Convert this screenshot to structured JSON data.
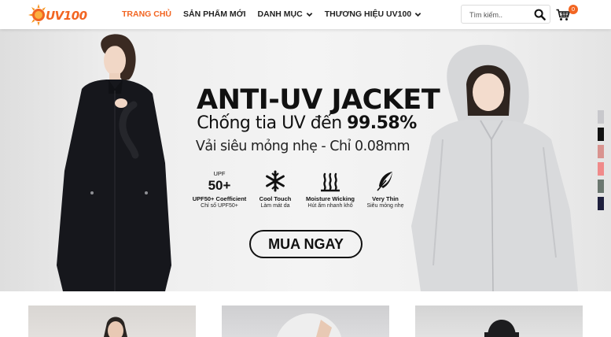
{
  "header": {
    "logo_text": "UV100",
    "nav": [
      {
        "label": "TRANG CHỦ",
        "active": true,
        "has_dropdown": false
      },
      {
        "label": "SẢN PHẨM MỚI",
        "active": false,
        "has_dropdown": false
      },
      {
        "label": "DANH MỤC",
        "active": false,
        "has_dropdown": true
      },
      {
        "label": "THƯƠNG HIỆU UV100",
        "active": false,
        "has_dropdown": true
      }
    ],
    "search_placeholder": "Tìm kiếm..",
    "cart_count": "0"
  },
  "banner": {
    "headline": "ANTI-UV JACKET",
    "subline_prefix": "Chống tia UV đến ",
    "subline_value": "99.58%",
    "thin_line": "Vải siêu mỏng nhẹ - Chỉ 0.08mm",
    "features": [
      {
        "icon": "upf50-icon",
        "badge_top": "UPF",
        "badge_main": "50+",
        "title": "UPF50+ Coefficient",
        "desc": "Chỉ số UPF50+"
      },
      {
        "icon": "snowflake-icon",
        "title": "Cool Touch",
        "desc": "Làm mát da"
      },
      {
        "icon": "moisture-wicking-icon",
        "title": "Moisture Wicking",
        "desc": "Hút ẩm nhanh khô"
      },
      {
        "icon": "feather-icon",
        "title": "Very Thin",
        "desc": "Siêu mỏng nhẹ"
      }
    ],
    "cta_label": "MUA NGAY",
    "swatches": [
      "#c8c8cc",
      "#111111",
      "#d9938f",
      "#f08a8a",
      "#6b7770",
      "#1e1f3d"
    ]
  },
  "colors": {
    "accent": "#f26522",
    "text": "#111111"
  }
}
